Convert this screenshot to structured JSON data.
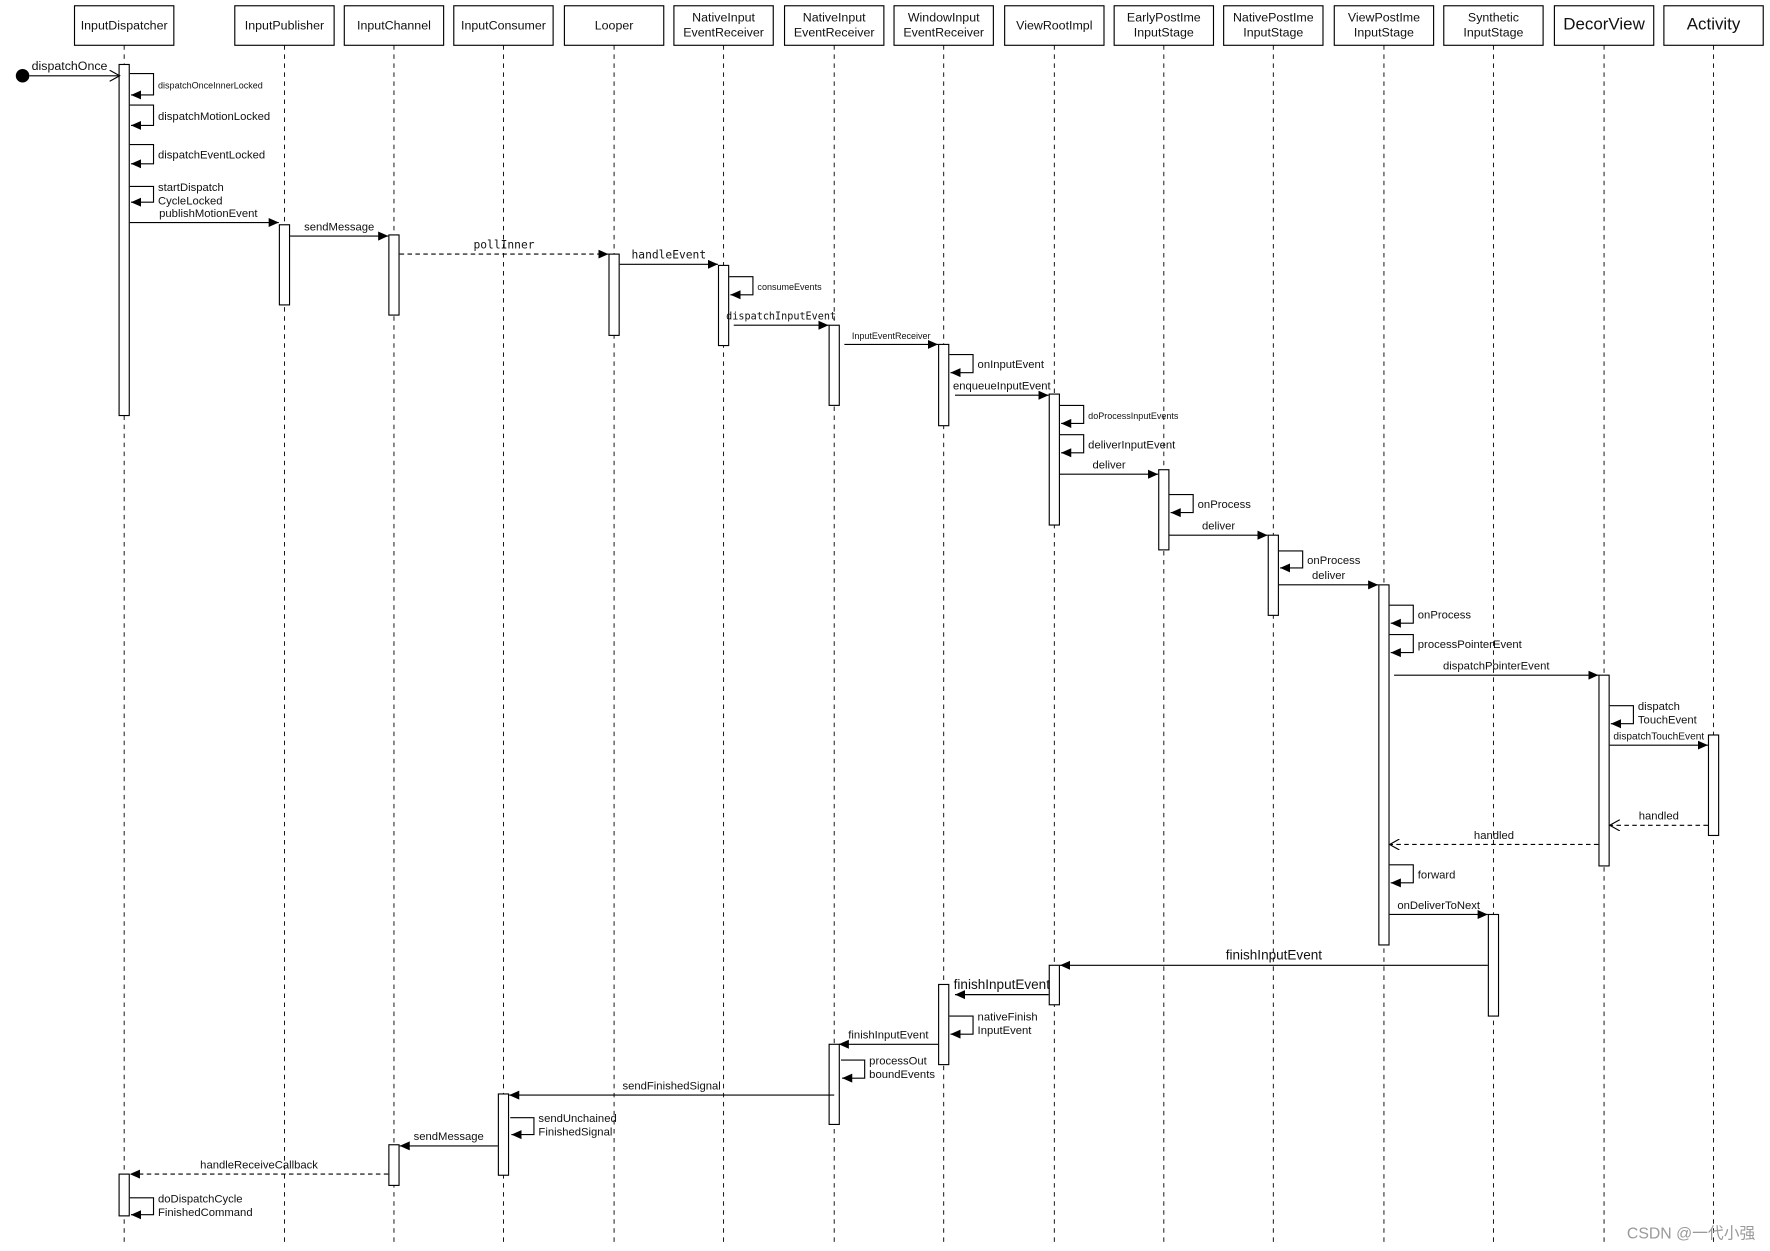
{
  "participants": [
    "InputDispatcher",
    "InputPublisher",
    "InputChannel",
    "InputConsumer",
    "Looper",
    "NativeInput\nEventReceiver",
    "NativeInput\nEventReceiver",
    "WindowInput\nEventReceiver",
    "ViewRootImpl",
    "EarlyPostIme\nInputStage",
    "NativePostIme\nInputStage",
    "ViewPostIme\nInputStage",
    "Synthetic\nInputStage",
    "DecorView",
    "Activity"
  ],
  "messages": {
    "dispatchOnce": "dispatchOnce",
    "publishMotionEvent": "publishMotionEvent",
    "sendMessage1": "sendMessage",
    "pollInner": "pollInner",
    "handleEvent": "handleEvent",
    "dispatchInputEvent": "dispatchInputEvent",
    "inputEventReceiver": "InputEventReceiver",
    "enqueueInputEvent": "enqueueInputEvent",
    "deliver1": "deliver",
    "deliver2": "deliver",
    "deliver3": "deliver",
    "dispatchPointerEvent": "dispatchPointerEvent",
    "dispatchTouchEvent": "dispatchTouchEvent",
    "handled1": "handled",
    "handled2": "handled",
    "onDeliverToNext": "onDeliverToNext",
    "finishInputEvent1": "finishInputEvent",
    "finishInputEvent2": "finishInputEvent",
    "finishInputEvent3": "finishInputEvent",
    "sendFinishedSignal": "sendFinishedSignal",
    "sendMessage2": "sendMessage",
    "handleReceiveCallback": "handleReceiveCallback"
  },
  "self_calls": {
    "dispatchOnceInnerLocked": "dispatchOnceInnerLocked",
    "dispatchMotionLocked": "dispatchMotionLocked",
    "dispatchEventLocked": "dispatchEventLocked",
    "startDispatchCycleLocked": "startDispatch\nCycleLocked",
    "consumeEvents": "consumeEvents",
    "onInputEvent": "onInputEvent",
    "doProcessInputEvents": "doProcessInputEvents",
    "deliverInputEvent": "deliverInputEvent",
    "onProcess1": "onProcess",
    "onProcess2": "onProcess",
    "onProcess3": "onProcess",
    "processPointerEvent": "processPointerEvent",
    "dispatchTouchEvent": "dispatch\nTouchEvent",
    "forward": "forward",
    "nativeFinishInputEvent": "nativeFinish\nInputEvent",
    "processOutboundEvents": "processOut\nboundEvents",
    "sendUnchainedFinishedSignal": "sendUnchained\nFinishedSignal",
    "doDispatchCycleFinishedCommand": "doDispatchCycle\nFinishedCommand"
  },
  "watermark": "CSDN @一代小强"
}
